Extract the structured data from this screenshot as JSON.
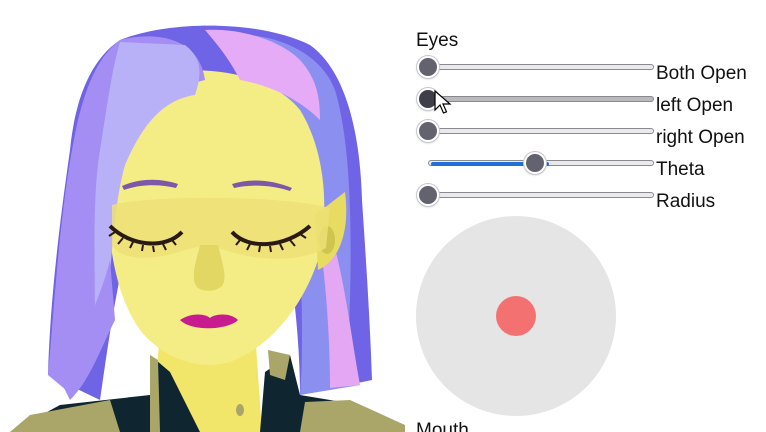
{
  "controls": {
    "eyes_title": "Eyes",
    "mouth_title": "Mouth",
    "sliders": [
      {
        "label": "Both Open",
        "value": 0.0
      },
      {
        "label": "left Open",
        "value": 0.0
      },
      {
        "label": "right Open",
        "value": 0.0
      },
      {
        "label": "Theta",
        "value": 0.53
      },
      {
        "label": "Radius",
        "value": 0.0
      }
    ]
  },
  "colors": {
    "accent": "#1f6fd6",
    "thumb": "#62636f",
    "joystick_bg": "#e6e5e5",
    "joystick_knob": "#f47171",
    "skin": "#f4ec85",
    "hair_purple": "#8f7cf2",
    "hair_pink": "#e2a8f2",
    "lips": "#c81b8f",
    "uniform": "#0f2530",
    "epaulette": "#aaa66a"
  },
  "icons": {
    "cursor": "arrow-pointer-icon"
  }
}
